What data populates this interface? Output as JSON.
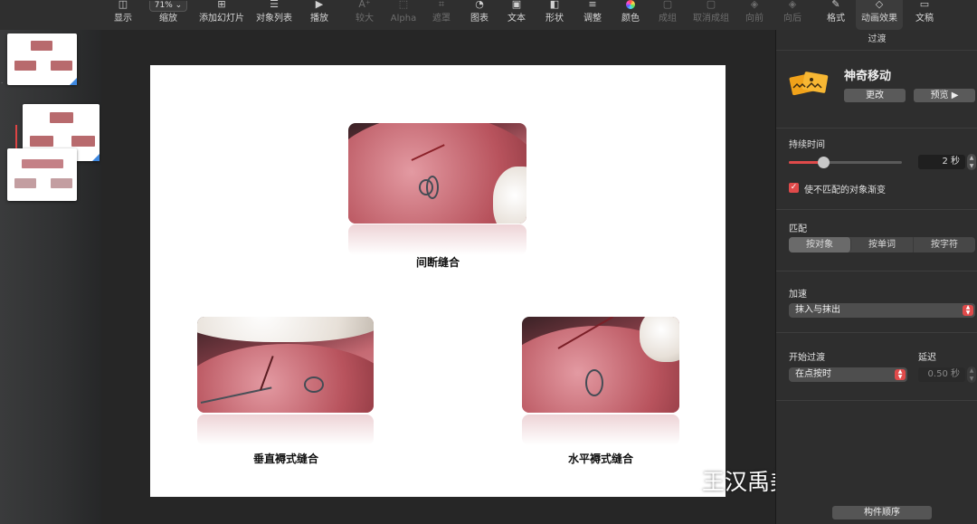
{
  "toolbar": {
    "zoom_value": "71%",
    "items": [
      {
        "label": "显示",
        "icon": "sidebar-icon"
      },
      {
        "label": "缩放",
        "icon": "zoom-icon"
      },
      {
        "label": "添加幻灯片",
        "icon": "add-slide-icon"
      },
      {
        "label": "对象列表",
        "icon": "list-icon"
      },
      {
        "label": "播放",
        "icon": "play-icon"
      },
      {
        "label": "较大",
        "icon": "text-larger-icon"
      },
      {
        "label": "Alpha",
        "icon": "alpha-icon"
      },
      {
        "label": "遮罩",
        "icon": "mask-icon"
      },
      {
        "label": "图表",
        "icon": "chart-icon"
      },
      {
        "label": "文本",
        "icon": "text-icon"
      },
      {
        "label": "形状",
        "icon": "shape-icon"
      },
      {
        "label": "调整",
        "icon": "adjust-icon"
      },
      {
        "label": "颜色",
        "icon": "color-wheel-icon"
      },
      {
        "label": "成组",
        "icon": "group-icon"
      },
      {
        "label": "取消成组",
        "icon": "ungroup-icon"
      },
      {
        "label": "向前",
        "icon": "bring-forward-icon"
      },
      {
        "label": "向后",
        "icon": "send-backward-icon"
      },
      {
        "label": "格式",
        "icon": "format-brush-icon"
      },
      {
        "label": "动画效果",
        "icon": "animate-icon"
      },
      {
        "label": "文稿",
        "icon": "document-icon"
      }
    ]
  },
  "slide": {
    "captions": [
      "间断缝合",
      "垂直褥式缝合",
      "水平褥式缝合"
    ]
  },
  "watermark": {
    "text": "王汉禹美学种植工作室"
  },
  "inspector": {
    "title": "过渡",
    "effect_name": "神奇移动",
    "change_button": "更改",
    "preview_button": "预览 ▶",
    "duration_label": "持续时间",
    "duration_value": "2 秒",
    "duration_fraction": 0.3,
    "fade_checkbox_label": "使不匹配的对象渐变",
    "fade_checked": true,
    "match_label": "匹配",
    "match_options": [
      "按对象",
      "按单词",
      "按字符"
    ],
    "match_selected": 0,
    "accel_label": "加速",
    "accel_value": "抹入与抹出",
    "start_label": "开始过渡",
    "start_value": "在点按时",
    "delay_label": "延迟",
    "delay_value": "0.50 秒",
    "order_button": "构件顺序"
  },
  "colors": {
    "accent": "#e04a4a",
    "selection": "#3e88e0"
  }
}
